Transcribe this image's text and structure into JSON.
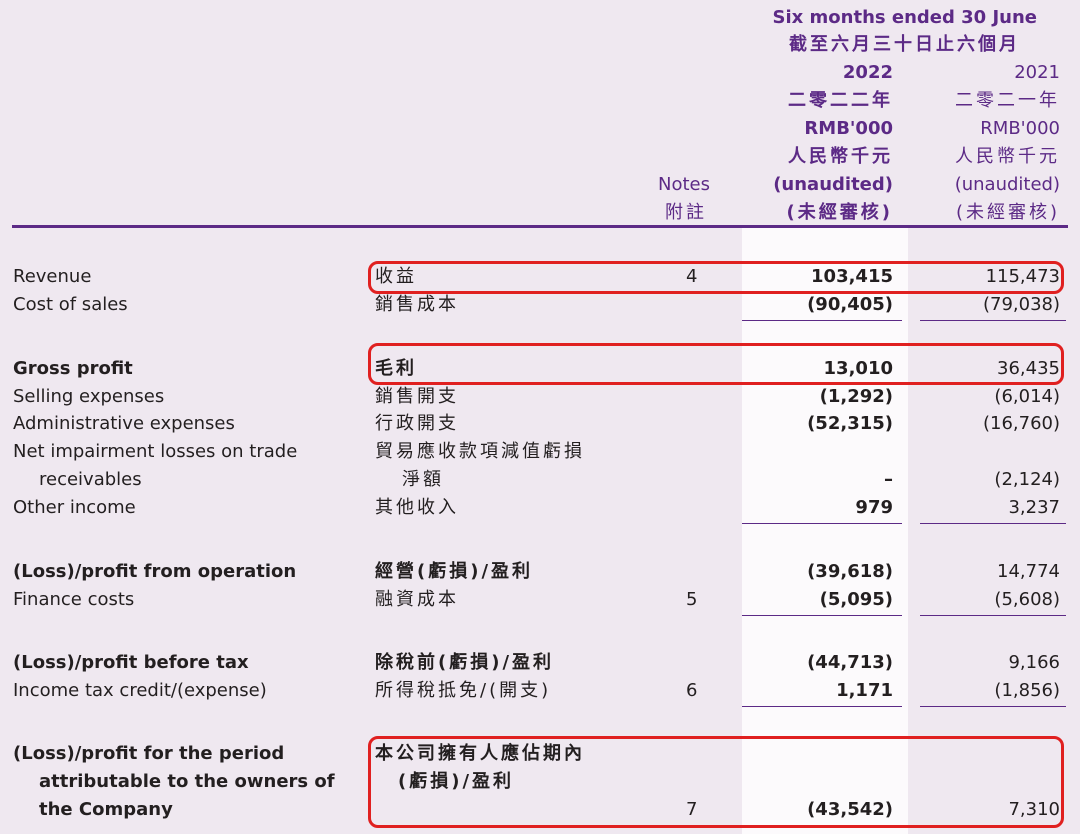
{
  "header": {
    "period_en": "Six months ended 30 June",
    "period_zh": "截至六月三十日止六個月",
    "col2022": {
      "year": "2022",
      "year_zh": "二零二二年",
      "unit": "RMB'000",
      "unit_zh": "人民幣千元",
      "audit": "(unaudited)",
      "audit_zh": "(未經審核)"
    },
    "col2021": {
      "year": "2021",
      "year_zh": "二零二一年",
      "unit": "RMB'000",
      "unit_zh": "人民幣千元",
      "audit": "(unaudited)",
      "audit_zh": "(未經審核)"
    },
    "notes": "Notes",
    "notes_zh": "附註"
  },
  "rows": {
    "revenue": {
      "en": "Revenue",
      "zh": "收益",
      "note": "4",
      "v2022": "103,415",
      "v2021": "115,473"
    },
    "cost_of_sales": {
      "en": "Cost of sales",
      "zh": "銷售成本",
      "v2022": "(90,405)",
      "v2021": "(79,038)"
    },
    "gross_profit": {
      "en": "Gross profit",
      "zh": "毛利",
      "v2022": "13,010",
      "v2021": "36,435"
    },
    "selling": {
      "en": "Selling expenses",
      "zh": "銷售開支",
      "v2022": "(1,292)",
      "v2021": "(6,014)"
    },
    "admin": {
      "en": "Administrative expenses",
      "zh": "行政開支",
      "v2022": "(52,315)",
      "v2021": "(16,760)"
    },
    "impairment": {
      "en1": "Net impairment losses on trade",
      "en2": "receivables",
      "zh1": "貿易應收款項減值虧損",
      "zh2": "淨額",
      "v2022": "–",
      "v2021": "(2,124)"
    },
    "other_income": {
      "en": "Other income",
      "zh": "其他收入",
      "v2022": "979",
      "v2021": "3,237"
    },
    "operation": {
      "en": "(Loss)/profit from operation",
      "zh": "經營(虧損)/盈利",
      "v2022": "(39,618)",
      "v2021": "14,774"
    },
    "finance": {
      "en": "Finance costs",
      "zh": "融資成本",
      "note": "5",
      "v2022": "(5,095)",
      "v2021": "(5,608)"
    },
    "before_tax": {
      "en": "(Loss)/profit before tax",
      "zh": "除稅前(虧損)/盈利",
      "v2022": "(44,713)",
      "v2021": "9,166"
    },
    "income_tax": {
      "en": "Income tax credit/(expense)",
      "zh": "所得稅抵免/(開支)",
      "note": "6",
      "v2022": "1,171",
      "v2021": "(1,856)"
    },
    "period": {
      "en1": "(Loss)/profit for the period",
      "en2": "attributable to the owners of",
      "en3": "the Company",
      "zh1": "本公司擁有人應佔期內",
      "zh2": "(虧損)/盈利",
      "note": "7",
      "v2022": "(43,542)",
      "v2021": "7,310"
    }
  },
  "colors": {
    "accent": "#5c2a86",
    "highlight": "#e02020",
    "background": "#efe8f0"
  }
}
